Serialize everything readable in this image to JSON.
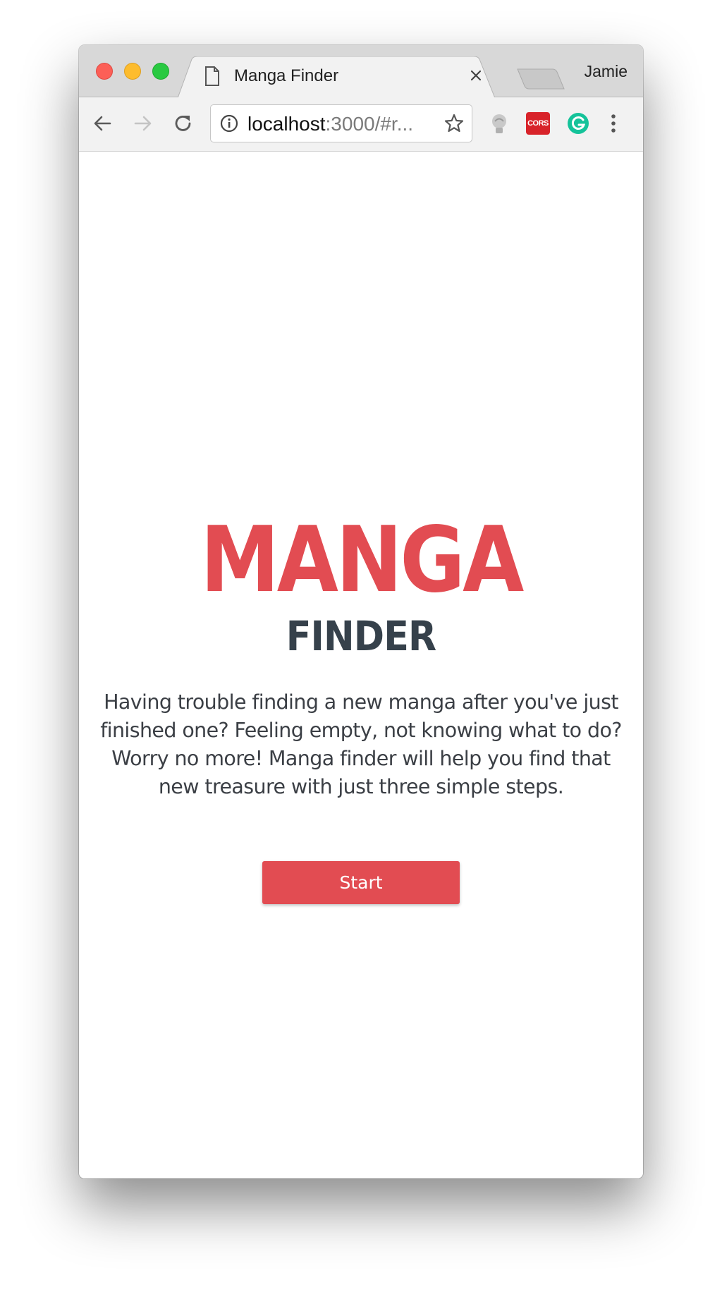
{
  "window": {
    "profile_name": "Jamie"
  },
  "tab": {
    "title": "Manga Finder",
    "icon": "document-icon"
  },
  "toolbar": {
    "url_host": "localhost",
    "url_rest": ":3000/#r...",
    "icons": [
      "back-arrow-icon",
      "forward-arrow-icon",
      "reload-icon",
      "info-icon",
      "star-icon",
      "lightbulb-extension-icon",
      "cors-extension-icon",
      "grammarly-extension-icon",
      "menu-icon"
    ],
    "cors_label": "CORS"
  },
  "page": {
    "title": "MANGA",
    "subtitle": "FINDER",
    "description": "Having trouble finding a new manga after you've just finished one? Feeling empty, not knowing what to do? Worry no more! Manga finder will help you find that new treasure with just three simple steps.",
    "start_label": "Start"
  },
  "colors": {
    "accent": "#e24c52",
    "subtitle": "#36414b",
    "text": "#3b3f45"
  }
}
